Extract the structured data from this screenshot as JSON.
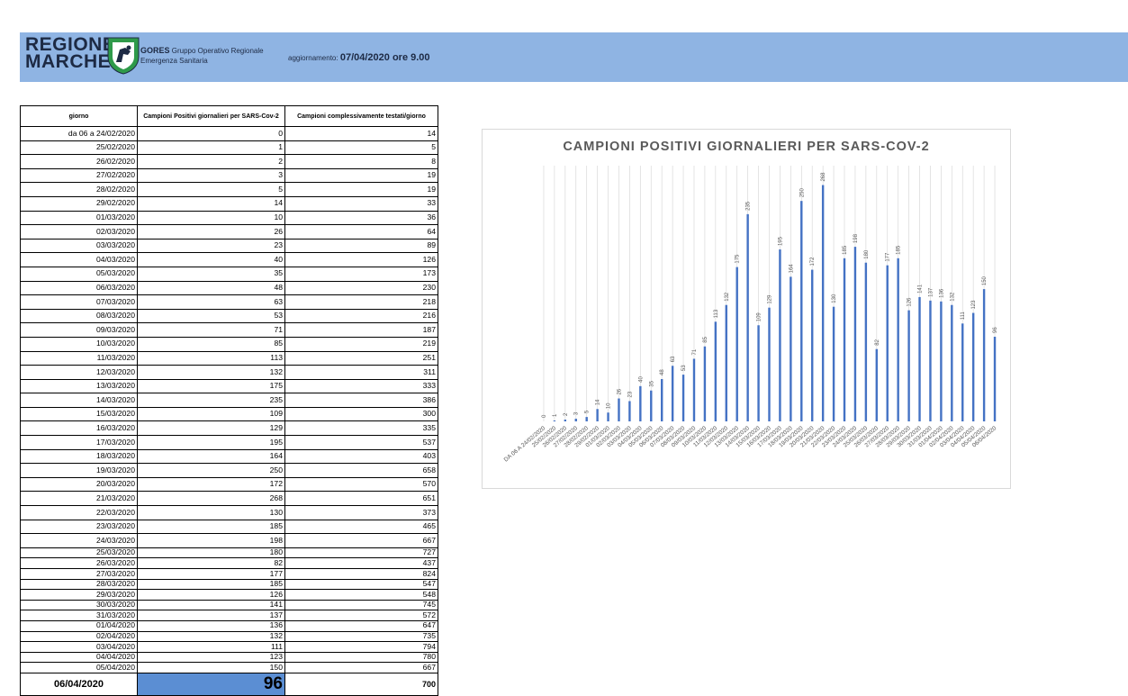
{
  "header": {
    "logo_line1": "REGIONE",
    "logo_line2": "MARCHE",
    "gores_bold": "GORES",
    "gores_line1": "Gruppo Operativo Regionale",
    "gores_line2": "Emergenza Sanitaria",
    "update_label": "aggiornamento:",
    "update_value": "07/04/2020 ore 9.00"
  },
  "table": {
    "headers": [
      "giorno",
      "Campioni Positivi giornalieri per SARS-Cov-2",
      "Campioni complessivamente testati/giorno"
    ],
    "rows": [
      [
        "da 06 a 24/02/2020",
        "0",
        "14"
      ],
      [
        "25/02/2020",
        "1",
        "5"
      ],
      [
        "26/02/2020",
        "2",
        "8"
      ],
      [
        "27/02/2020",
        "3",
        "19"
      ],
      [
        "28/02/2020",
        "5",
        "19"
      ],
      [
        "29/02/2020",
        "14",
        "33"
      ],
      [
        "01/03/2020",
        "10",
        "36"
      ],
      [
        "02/03/2020",
        "26",
        "64"
      ],
      [
        "03/03/2020",
        "23",
        "89"
      ],
      [
        "04/03/2020",
        "40",
        "126"
      ],
      [
        "05/03/2020",
        "35",
        "173"
      ],
      [
        "06/03/2020",
        "48",
        "230"
      ],
      [
        "07/03/2020",
        "63",
        "218"
      ],
      [
        "08/03/2020",
        "53",
        "216"
      ],
      [
        "09/03/2020",
        "71",
        "187"
      ],
      [
        "10/03/2020",
        "85",
        "219"
      ],
      [
        "11/03/2020",
        "113",
        "251"
      ],
      [
        "12/03/2020",
        "132",
        "311"
      ],
      [
        "13/03/2020",
        "175",
        "333"
      ],
      [
        "14/03/2020",
        "235",
        "386"
      ],
      [
        "15/03/2020",
        "109",
        "300"
      ],
      [
        "16/03/2020",
        "129",
        "335"
      ],
      [
        "17/03/2020",
        "195",
        "537"
      ],
      [
        "18/03/2020",
        "164",
        "403"
      ],
      [
        "19/03/2020",
        "250",
        "658"
      ],
      [
        "20/03/2020",
        "172",
        "570"
      ],
      [
        "21/03/2020",
        "268",
        "651"
      ],
      [
        "22/03/2020",
        "130",
        "373"
      ],
      [
        "23/03/2020",
        "185",
        "465"
      ],
      [
        "24/03/2020",
        "198",
        "667"
      ],
      [
        "25/03/2020",
        "180",
        "727"
      ],
      [
        "26/03/2020",
        "82",
        "437"
      ],
      [
        "27/03/2020",
        "177",
        "824"
      ],
      [
        "28/03/2020",
        "185",
        "547"
      ],
      [
        "29/03/2020",
        "126",
        "548"
      ],
      [
        "30/03/2020",
        "141",
        "745"
      ],
      [
        "31/03/2020",
        "137",
        "572"
      ],
      [
        "01/04/2020",
        "136",
        "647"
      ],
      [
        "02/04/2020",
        "132",
        "735"
      ],
      [
        "03/04/2020",
        "111",
        "794"
      ],
      [
        "04/04/2020",
        "123",
        "780"
      ],
      [
        "05/04/2020",
        "150",
        "667"
      ]
    ],
    "last_row": [
      "06/04/2020",
      "96",
      "700"
    ]
  },
  "colors": {
    "header_band": "#8fb4e3",
    "bar": "#4472c4",
    "highlight_cell": "#5b8ed3"
  },
  "chart_data": {
    "type": "bar",
    "title": "CAMPIONI POSITIVI GIORNALIERI PER SARS-COV-2",
    "xlabel": "",
    "ylabel": "",
    "ylim": [
      0,
      290
    ],
    "grid": true,
    "categories": [
      "DA 06 A 24/02/2020",
      "25/02/2020",
      "26/02/2020",
      "27/02/2020",
      "28/02/2020",
      "29/02/2020",
      "01/03/2020",
      "02/03/2020",
      "03/03/2020",
      "04/03/2020",
      "05/03/2020",
      "06/03/2020",
      "07/03/2020",
      "08/03/2020",
      "09/03/2020",
      "10/03/2020",
      "11/03/2020",
      "12/03/2020",
      "13/03/2020",
      "14/03/2020",
      "15/03/2020",
      "16/03/2020",
      "17/03/2020",
      "18/03/2020",
      "19/03/2020",
      "20/03/2020",
      "21/03/2020",
      "22/03/2020",
      "23/03/2020",
      "24/03/2020",
      "25/03/2020",
      "26/03/2020",
      "27/03/2020",
      "28/03/2020",
      "29/03/2020",
      "30/03/2020",
      "31/03/2020",
      "01/04/2020",
      "02/04/2020",
      "03/04/2020",
      "04/04/2020",
      "05/04/2020",
      "06/04/2020"
    ],
    "values": [
      0,
      1,
      2,
      3,
      5,
      14,
      10,
      26,
      23,
      40,
      35,
      48,
      63,
      53,
      71,
      85,
      113,
      132,
      175,
      235,
      109,
      129,
      195,
      164,
      250,
      172,
      268,
      130,
      185,
      198,
      180,
      82,
      177,
      185,
      126,
      141,
      137,
      136,
      132,
      111,
      123,
      150,
      96
    ]
  }
}
